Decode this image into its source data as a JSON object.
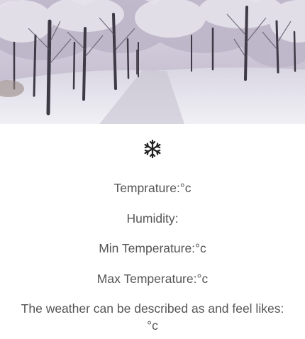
{
  "hero": {
    "alt": "snowy park with trees",
    "icon": "snow-scene-image"
  },
  "weather": {
    "icon": "snowflake-icon",
    "icon_glyph": "❄",
    "icon_color": "#222222",
    "temperature": "Temprature:°c",
    "humidity": "Humidity:",
    "min_temp": "Min Temperature:°c",
    "max_temp": "Max Temperature:°c",
    "description_line1": "The weather can be described as and feel likes:",
    "description_line2": "°c"
  },
  "colors": {
    "text": "#555555",
    "background": "#ffffff"
  }
}
